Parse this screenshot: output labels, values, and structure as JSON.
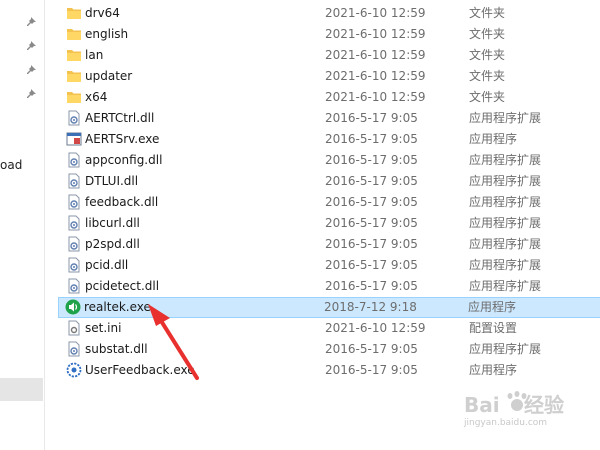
{
  "nav": {
    "partial_label": "oad"
  },
  "files": [
    {
      "icon": "folder-icon",
      "name": "drv64",
      "date": "2021-6-10 12:59",
      "type": "文件夹"
    },
    {
      "icon": "folder-icon",
      "name": "english",
      "date": "2021-6-10 12:59",
      "type": "文件夹"
    },
    {
      "icon": "folder-icon",
      "name": "lan",
      "date": "2021-6-10 12:59",
      "type": "文件夹"
    },
    {
      "icon": "folder-icon",
      "name": "updater",
      "date": "2021-6-10 12:59",
      "type": "文件夹"
    },
    {
      "icon": "folder-icon",
      "name": "x64",
      "date": "2021-6-10 12:59",
      "type": "文件夹"
    },
    {
      "icon": "dll-icon",
      "name": "AERTCtrl.dll",
      "date": "2016-5-17 9:05",
      "type": "应用程序扩展"
    },
    {
      "icon": "exe-icon",
      "name": "AERTSrv.exe",
      "date": "2016-5-17 9:05",
      "type": "应用程序"
    },
    {
      "icon": "dll-icon",
      "name": "appconfig.dll",
      "date": "2016-5-17 9:05",
      "type": "应用程序扩展"
    },
    {
      "icon": "dll-icon",
      "name": "DTLUI.dll",
      "date": "2016-5-17 9:05",
      "type": "应用程序扩展"
    },
    {
      "icon": "dll-icon",
      "name": "feedback.dll",
      "date": "2016-5-17 9:05",
      "type": "应用程序扩展"
    },
    {
      "icon": "dll-icon",
      "name": "libcurl.dll",
      "date": "2016-5-17 9:05",
      "type": "应用程序扩展"
    },
    {
      "icon": "dll-icon",
      "name": "p2spd.dll",
      "date": "2016-5-17 9:05",
      "type": "应用程序扩展"
    },
    {
      "icon": "dll-icon",
      "name": "pcid.dll",
      "date": "2016-5-17 9:05",
      "type": "应用程序扩展"
    },
    {
      "icon": "dll-icon",
      "name": "pcidetect.dll",
      "date": "2016-5-17 9:05",
      "type": "应用程序扩展"
    },
    {
      "icon": "speaker-icon",
      "name": "realtek.exe",
      "date": "2018-7-12 9:18",
      "type": "应用程序",
      "selected": true
    },
    {
      "icon": "ini-icon",
      "name": "set.ini",
      "date": "2021-6-10 12:59",
      "type": "配置设置"
    },
    {
      "icon": "dll-icon",
      "name": "substat.dll",
      "date": "2016-5-17 9:05",
      "type": "应用程序扩展"
    },
    {
      "icon": "gear-icon",
      "name": "UserFeedback.exe",
      "date": "2016-5-17 9:05",
      "type": "应用程序"
    }
  ],
  "colors": {
    "folder": "#f4c24f",
    "selection": "#cce8ff",
    "arrow": "#e8312f",
    "speaker": "#1fa34a"
  },
  "watermark": {
    "brand": "Bai du 经验",
    "url": "jingyan.baidu.com"
  }
}
